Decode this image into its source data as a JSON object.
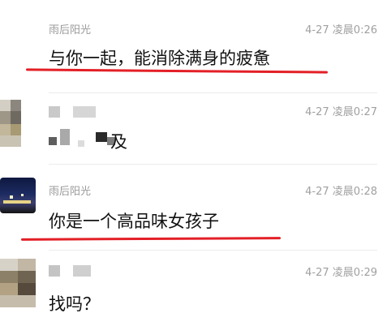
{
  "messages": [
    {
      "name": "雨后阳光",
      "time": "4-27 凌晨0:26",
      "text": "与你一起，能消除满身的疲惫"
    },
    {
      "name": "",
      "time": "4-27 凌晨0:27",
      "text": "及"
    },
    {
      "name": "雨后阳光",
      "time": "4-27 凌晨0:28",
      "text": "你是一个高品味女孩子"
    },
    {
      "name": "",
      "time": "4-27 凌晨0:29",
      "text": "找吗？"
    }
  ],
  "colors": {
    "underline": "#e31f26",
    "meta": "#9a9a9a"
  }
}
